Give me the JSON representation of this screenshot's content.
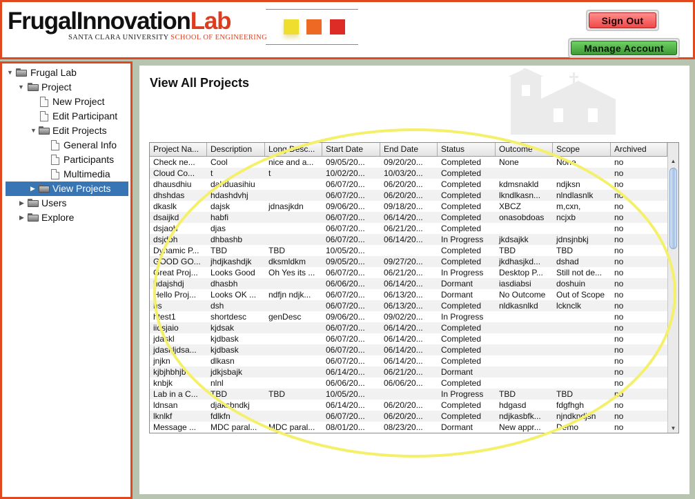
{
  "header": {
    "logo_part1": "Frugal",
    "logo_part2": "Innovation",
    "logo_part3": "Lab",
    "logo_university": "SANTA CLARA UNIVERSITY",
    "logo_school": "SCHOOL OF ENGINEERING",
    "swatch_colors": [
      "#f0de2e",
      "#ee6a24",
      "#dd2b26"
    ],
    "sign_out_label": "Sign Out",
    "manage_account_label": "Manage Account"
  },
  "sidebar": {
    "root": "Frugal Lab",
    "project": "Project",
    "new_project": "New Project",
    "edit_participant": "Edit Participant",
    "edit_projects": "Edit Projects",
    "general_info": "General Info",
    "participants": "Participants",
    "multimedia": "Multimedia",
    "view_projects": "View Projects",
    "users": "Users",
    "explore": "Explore"
  },
  "main": {
    "title": "View All Projects"
  },
  "table": {
    "columns": [
      "Project Na...",
      "Description",
      "Long Desc...",
      "Start Date",
      "End Date",
      "Status",
      "Outcome",
      "Scope",
      "Archived"
    ],
    "rows": [
      [
        "Check ne...",
        "Cool",
        "nice and a...",
        "09/05/20...",
        "09/20/20...",
        "Completed",
        "None",
        "None",
        "no"
      ],
      [
        "Cloud Co...",
        "t",
        "t",
        "10/02/20...",
        "10/03/20...",
        "Completed",
        "",
        "",
        "no"
      ],
      [
        "dhausdhiu",
        "dahduasihiu",
        "",
        "06/07/20...",
        "06/20/20...",
        "Completed",
        "kdmsnakld",
        "ndjksn",
        "no"
      ],
      [
        "dhshdas",
        "hdashdvhj",
        "",
        "06/07/20...",
        "06/20/20...",
        "Completed",
        "lkndlkasn...",
        "nlndlasnlk",
        "no"
      ],
      [
        "dkaslk",
        "dajsk",
        "jdnasjkdn",
        "09/06/20...",
        "09/18/20...",
        "Completed",
        "XBCZ",
        "m,cxn,",
        "no"
      ],
      [
        "dsaijkd",
        "habfi",
        "",
        "06/07/20...",
        "06/14/20...",
        "Completed",
        "onasobdoas",
        "ncjxb",
        "no"
      ],
      [
        "dsjaoh",
        "djas",
        "",
        "06/07/20...",
        "06/21/20...",
        "Completed",
        "",
        "",
        "no"
      ],
      [
        "dsjdbh",
        "dhbashb",
        "",
        "06/07/20...",
        "06/14/20...",
        "In Progress",
        "jkdsajkk",
        "jdnsjnbkj",
        "no"
      ],
      [
        "Dynamic P...",
        "TBD",
        "TBD",
        "10/05/20...",
        "",
        "Completed",
        "TBD",
        "TBD",
        "no"
      ],
      [
        "GOOD GO...",
        "jhdjkashdjk",
        "dksmldkm",
        "09/05/20...",
        "09/27/20...",
        "Completed",
        "jkdhasjkd...",
        "dshad",
        "no"
      ],
      [
        "Great Proj...",
        "Looks Good",
        "Oh Yes its ...",
        "06/07/20...",
        "06/21/20...",
        "In Progress",
        "Desktop P...",
        "Still not de...",
        "no"
      ],
      [
        "hdajshdj",
        "dhasbh",
        "",
        "06/06/20...",
        "06/14/20...",
        "Dormant",
        "iasdiabsi",
        "doshuin",
        "no"
      ],
      [
        "Hello Proj...",
        "Looks OK ...",
        "ndfjn ndjk...",
        "06/07/20...",
        "06/13/20...",
        "Dormant",
        "No Outcome",
        "Out of Scope",
        "no"
      ],
      [
        "hs",
        "dsh",
        "",
        "06/07/20...",
        "06/13/20...",
        "Completed",
        "nldkasnlkd",
        "lcknclk",
        "no"
      ],
      [
        "htest1",
        "shortdesc",
        "genDesc",
        "09/06/20...",
        "09/02/20...",
        "In Progress",
        "",
        "",
        "no"
      ],
      [
        "iidsjaio",
        "kjdsak",
        "",
        "06/07/20...",
        "06/14/20...",
        "Completed",
        "",
        "",
        "no"
      ],
      [
        "jdaskl",
        "kjdbask",
        "",
        "06/07/20...",
        "06/14/20...",
        "Completed",
        "",
        "",
        "no"
      ],
      [
        "jdaskljdsa...",
        "kjdbask",
        "",
        "06/07/20...",
        "06/14/20...",
        "Completed",
        "",
        "",
        "no"
      ],
      [
        "jnjkn",
        "dlkasn",
        "",
        "06/07/20...",
        "06/14/20...",
        "Completed",
        "",
        "",
        "no"
      ],
      [
        "kjbjhbhjb",
        "jdkjsbajk",
        "",
        "06/14/20...",
        "06/21/20...",
        "Dormant",
        "",
        "",
        "no"
      ],
      [
        "knbjk",
        "nlnl",
        "",
        "06/06/20...",
        "06/06/20...",
        "Completed",
        "",
        "",
        "no"
      ],
      [
        "Lab in a C...",
        "TBD",
        "TBD",
        "10/05/20...",
        "",
        "In Progress",
        "TBD",
        "TBD",
        "no"
      ],
      [
        "ldnsan",
        "djaksbndkj",
        "",
        "06/14/20...",
        "06/20/20...",
        "Completed",
        "hdgasd",
        "fdgfhgh",
        "no"
      ],
      [
        "lknlkf",
        "fdlkfn",
        "",
        "06/07/20...",
        "06/20/20...",
        "Completed",
        "ndjkasbfk...",
        "njndkndjsn",
        "no"
      ],
      [
        "Message ...",
        "MDC paral...",
        "MDC paral...",
        "08/01/20...",
        "08/23/20...",
        "Dormant",
        "New appr...",
        "Demo",
        "no"
      ]
    ]
  }
}
